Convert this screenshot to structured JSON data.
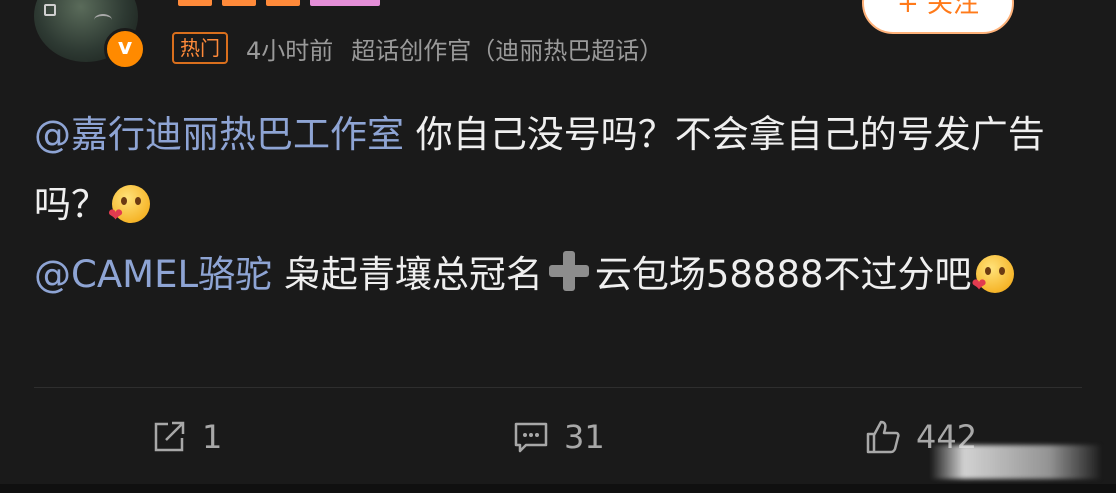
{
  "header": {
    "follow_label": "+ 关注",
    "hot_tag": "热门",
    "time": "4小时前",
    "source": "超话创作官（迪丽热巴超话）",
    "verified_badge": "v"
  },
  "post": {
    "mention1": "@嘉行迪丽热巴工作室",
    "text1": " 你自己没号吗？不会拿自己的号发广告吗？",
    "mention2": "@CAMEL骆驼",
    "text2a": " 枭起青壤总冠名",
    "text2b": "云包场58888不过分吧",
    "emoji": "blushing-face-with-heart"
  },
  "actions": {
    "repost_count": "1",
    "comment_count": "31",
    "like_count": "442"
  },
  "colors": {
    "background": "#1a1a1a",
    "mention": "#8ea4d4",
    "accent_orange": "#ff8a3a"
  }
}
